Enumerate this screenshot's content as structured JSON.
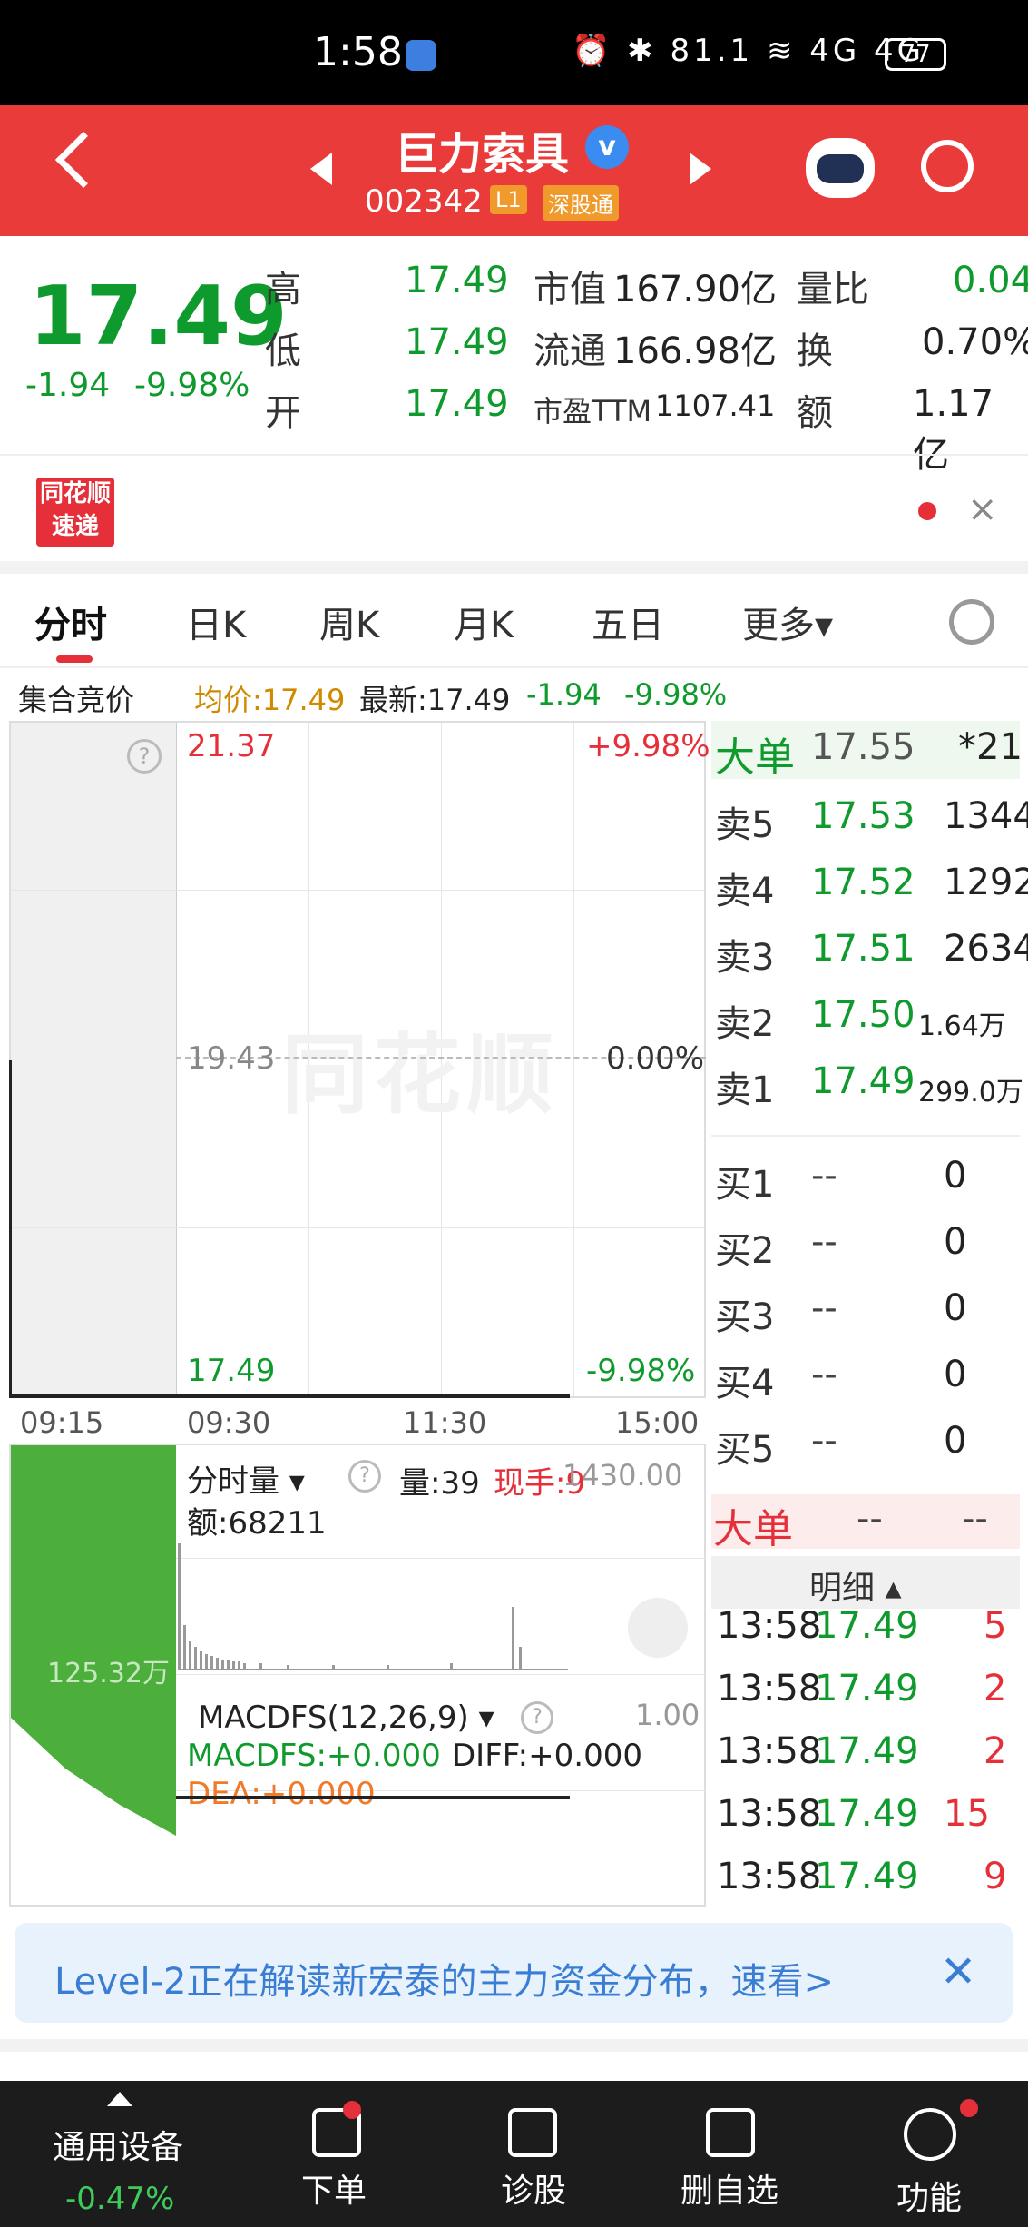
{
  "status_bar": {
    "time": "1:58",
    "icons": "⏰ ✱ 81.1 ≋ 4G 4G",
    "battery": "77"
  },
  "header": {
    "stock_name": "巨力索具",
    "verified": "v",
    "code": "002342",
    "badge_level": "L1",
    "badge_market": "深股通"
  },
  "quote": {
    "price": "17.49",
    "change": "-1.94",
    "change_pct": "-9.98%",
    "rows": [
      {
        "l1": "高",
        "v1": "17.49",
        "l2": "市值",
        "v2": "167.90亿",
        "l3": "量比",
        "v3": "0.04"
      },
      {
        "l1": "低",
        "v1": "17.49",
        "l2": "流通",
        "v2": "166.98亿",
        "l3": "换",
        "v3": "0.70%"
      },
      {
        "l1": "开",
        "v1": "17.49",
        "l2": "市盈TTM",
        "v2": "1107.41",
        "l3": "额",
        "v3": "1.17亿"
      }
    ]
  },
  "ad": {
    "logo": "同花顺速递"
  },
  "tabs": [
    "分时",
    "日K",
    "周K",
    "月K",
    "五日",
    "更多▾"
  ],
  "info": {
    "label": "集合竞价",
    "avg": "均价:17.49",
    "latest": "最新:17.49",
    "change": "-1.94",
    "pct": "-9.98%"
  },
  "chart": {
    "y_top": "21.37",
    "y_mid": "19.43",
    "y_bot": "17.49",
    "pct_top": "+9.98%",
    "pct_mid": "0.00%",
    "pct_bot": "-9.98%",
    "times": [
      "09:15",
      "09:30",
      "11:30",
      "15:00"
    ],
    "watermark": "同花顺",
    "help": "?"
  },
  "volume": {
    "selector": "分时量 ▾",
    "vol": "量:39",
    "now": "现手:9",
    "top": "1430.00",
    "amount": "额:68211",
    "pre_label": "125.32万"
  },
  "macd": {
    "selector": "MACDFS(12,26,9) ▾",
    "top": "1.00",
    "macdfs": "MACDFS:+0.000",
    "diff": "DIFF:+0.000",
    "dea": "DEA:+0.000"
  },
  "order_book": {
    "big_top": {
      "label": "大单",
      "price": "17.55",
      "vol": "*21"
    },
    "sells": [
      {
        "label": "卖5",
        "price": "17.53",
        "vol": "1344"
      },
      {
        "label": "卖4",
        "price": "17.52",
        "vol": "1292"
      },
      {
        "label": "卖3",
        "price": "17.51",
        "vol": "2634"
      },
      {
        "label": "卖2",
        "price": "17.50",
        "vol": "1.64万"
      },
      {
        "label": "卖1",
        "price": "17.49",
        "vol": "299.0万"
      }
    ],
    "buys": [
      {
        "label": "买1",
        "price": "--",
        "vol": "0"
      },
      {
        "label": "买2",
        "price": "--",
        "vol": "0"
      },
      {
        "label": "买3",
        "price": "--",
        "vol": "0"
      },
      {
        "label": "买4",
        "price": "--",
        "vol": "0"
      },
      {
        "label": "买5",
        "price": "--",
        "vol": "0"
      }
    ],
    "big_bottom": {
      "label": "大单",
      "price": "--",
      "vol": "--"
    },
    "detail_label": "明细 ▴",
    "ticks": [
      {
        "time": "13:58",
        "price": "17.49",
        "vol": "5"
      },
      {
        "time": "13:58",
        "price": "17.49",
        "vol": "2"
      },
      {
        "time": "13:58",
        "price": "17.49",
        "vol": "2"
      },
      {
        "time": "13:58",
        "price": "17.49",
        "vol": "15"
      },
      {
        "time": "13:58",
        "price": "17.49",
        "vol": "9"
      }
    ]
  },
  "banner": {
    "text": "Level-2正在解读新宏泰的主力资金分布，速看>",
    "close": "✕"
  },
  "bottom_nav": {
    "device_label": "通用设备",
    "device_pct": "-0.47%",
    "items": [
      "下单",
      "诊股",
      "删自选",
      "功能"
    ]
  },
  "colors": {
    "header_red": "#ea3b3b",
    "down_green": "#0f9a2d",
    "up_red": "#e5303a"
  }
}
